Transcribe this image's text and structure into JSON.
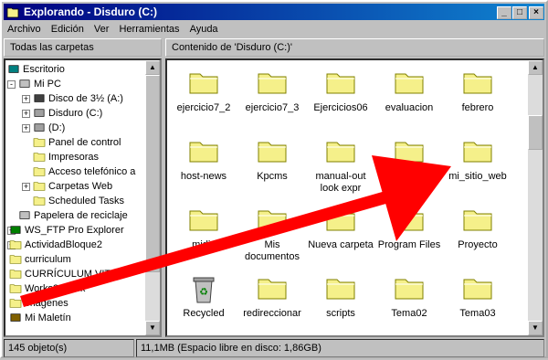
{
  "window": {
    "title": "Explorando - Disduro (C:)",
    "min_label": "_",
    "max_label": "□",
    "close_label": "×"
  },
  "menu": [
    "Archivo",
    "Edición",
    "Ver",
    "Herramientas",
    "Ayuda"
  ],
  "left_header": "Todas las carpetas",
  "right_header": "Contenido de 'Disduro (C:)'",
  "tree": [
    {
      "label": "Escritorio",
      "icon": "desktop-icon"
    },
    {
      "label": "Mi PC",
      "icon": "computer-icon"
    },
    {
      "label": "Disco de 3½ (A:)",
      "icon": "floppy-icon"
    },
    {
      "label": "Disduro (C:)",
      "icon": "hard-drive-icon"
    },
    {
      "label": "(D:)",
      "icon": "cd-drive-icon"
    },
    {
      "label": "Panel de control",
      "icon": "control-panel-icon"
    },
    {
      "label": "Impresoras",
      "icon": "printers-icon"
    },
    {
      "label": "Acceso telefónico a",
      "icon": "dialup-icon"
    },
    {
      "label": "Carpetas Web",
      "icon": "web-folders-icon"
    },
    {
      "label": "Scheduled Tasks",
      "icon": "scheduled-tasks-icon"
    },
    {
      "label": "Papelera de reciclaje",
      "icon": "recycle-bin-icon"
    },
    {
      "label": "WS_FTP Pro Explorer",
      "icon": "ftp-icon"
    },
    {
      "label": "ActividadBloque2",
      "icon": "folder-icon"
    },
    {
      "label": "curriculum",
      "icon": "folder-icon"
    },
    {
      "label": "CURRÍCULUM VITAE",
      "icon": "folder-icon"
    },
    {
      "label": "Works3 crack",
      "icon": "folder-icon"
    },
    {
      "label": "imagenes",
      "icon": "folder-icon"
    },
    {
      "label": "Mi Maletín",
      "icon": "briefcase-icon"
    }
  ],
  "files": [
    {
      "label": "ejercicio7_2",
      "icon": "folder-icon"
    },
    {
      "label": "ejercicio7_3",
      "icon": "folder-icon"
    },
    {
      "label": "Ejercicios06",
      "icon": "folder-icon"
    },
    {
      "label": "evaluacion",
      "icon": "folder-icon"
    },
    {
      "label": "febrero",
      "icon": "folder-icon"
    },
    {
      "label": "host-news",
      "icon": "folder-icon"
    },
    {
      "label": "Kpcms",
      "icon": "folder-icon"
    },
    {
      "label": "manual-out look expr",
      "icon": "folder-icon"
    },
    {
      "label": "",
      "icon": "folder-icon"
    },
    {
      "label": "mi_sitio_web",
      "icon": "folder-icon"
    },
    {
      "label": "midis",
      "icon": "folder-icon"
    },
    {
      "label": "Mis documentos",
      "icon": "folder-icon"
    },
    {
      "label": "Nueva carpeta",
      "icon": "folder-icon"
    },
    {
      "label": "Program Files",
      "icon": "folder-icon"
    },
    {
      "label": "Proyecto",
      "icon": "folder-icon"
    },
    {
      "label": "Recycled",
      "icon": "recycle-bin-icon"
    },
    {
      "label": "redireccionar",
      "icon": "folder-icon"
    },
    {
      "label": "scripts",
      "icon": "folder-icon"
    },
    {
      "label": "Tema02",
      "icon": "folder-icon"
    },
    {
      "label": "Tema03",
      "icon": "folder-icon"
    }
  ],
  "status": {
    "count": "145 objeto(s)",
    "space": "11,1MB (Espacio libre en disco: 1,86GB)"
  },
  "colors": {
    "title_start": "#000080",
    "title_end": "#1084d0",
    "folder": "#f5f08a",
    "arrow": "#ff0000"
  }
}
